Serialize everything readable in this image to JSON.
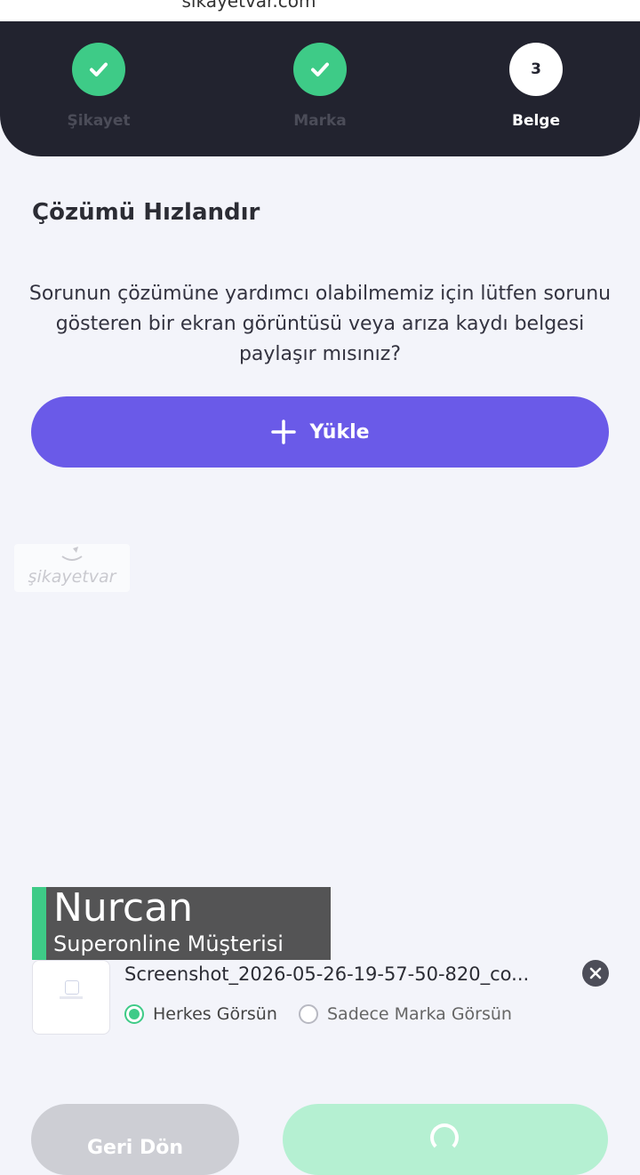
{
  "browser": {
    "url": "sikayetvar.com"
  },
  "stepper": {
    "steps": [
      {
        "label": "Şikayet",
        "state": "done"
      },
      {
        "label": "Marka",
        "state": "done"
      },
      {
        "label": "Belge",
        "state": "current",
        "number": "3"
      }
    ]
  },
  "main": {
    "title": "Çözümü Hızlandır",
    "description": "Sorunun çözümüne yardımcı olabilmemiz için lütfen sorunu gösteren bir ekran görüntüsü veya arıza kaydı belgesi paylaşır mısınız?",
    "upload_label": "Yükle"
  },
  "watermark": {
    "text": "şikayetvar"
  },
  "caption": {
    "name": "Nurcan",
    "subtitle": "Superonline Müşterisi"
  },
  "attachment": {
    "filename": "Screenshot_2026-05-26-19-57-50-820_co...",
    "visibility_options": [
      {
        "label": "Herkes Görsün",
        "selected": true
      },
      {
        "label": "Sadece Marka Görsün",
        "selected": false
      }
    ]
  },
  "footer": {
    "back_label": "Geri Dön"
  },
  "colors": {
    "accent_purple": "#6a5ae8",
    "success_green": "#3ecb87",
    "header_dark": "#22232f",
    "background": "#f3f4fa"
  }
}
